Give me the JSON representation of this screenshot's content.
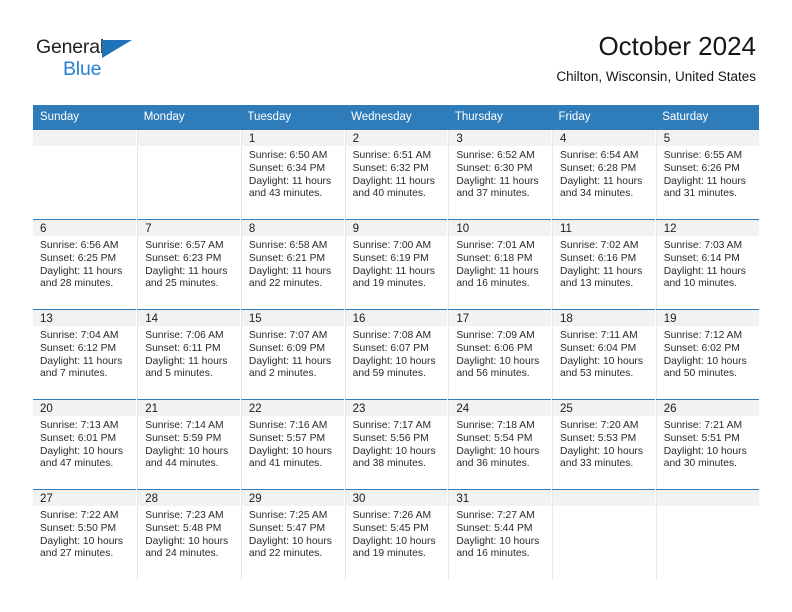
{
  "brand": {
    "name_part1": "General",
    "name_part2": "Blue",
    "triangle_color": "#1f72b8",
    "blue_color": "#2a7fd4"
  },
  "header": {
    "title": "October 2024",
    "subtitle": "Chilton, Wisconsin, United States"
  },
  "theme": {
    "header_row_color": "#2f7cba",
    "daynum_band_color": "#f2f2f2",
    "text_color": "#2a2a2a"
  },
  "weekday_headers": [
    "Sunday",
    "Monday",
    "Tuesday",
    "Wednesday",
    "Thursday",
    "Friday",
    "Saturday"
  ],
  "labels": {
    "sunrise_prefix": "Sunrise:",
    "sunset_prefix": "Sunset:",
    "daylight_prefix": "Daylight:"
  },
  "weeks": [
    [
      {
        "day": "",
        "sunrise": "",
        "sunset": "",
        "daylight_line1": "",
        "daylight_line2": ""
      },
      {
        "day": "",
        "sunrise": "",
        "sunset": "",
        "daylight_line1": "",
        "daylight_line2": ""
      },
      {
        "day": "1",
        "sunrise": "Sunrise: 6:50 AM",
        "sunset": "Sunset: 6:34 PM",
        "daylight_line1": "Daylight: 11 hours",
        "daylight_line2": "and 43 minutes."
      },
      {
        "day": "2",
        "sunrise": "Sunrise: 6:51 AM",
        "sunset": "Sunset: 6:32 PM",
        "daylight_line1": "Daylight: 11 hours",
        "daylight_line2": "and 40 minutes."
      },
      {
        "day": "3",
        "sunrise": "Sunrise: 6:52 AM",
        "sunset": "Sunset: 6:30 PM",
        "daylight_line1": "Daylight: 11 hours",
        "daylight_line2": "and 37 minutes."
      },
      {
        "day": "4",
        "sunrise": "Sunrise: 6:54 AM",
        "sunset": "Sunset: 6:28 PM",
        "daylight_line1": "Daylight: 11 hours",
        "daylight_line2": "and 34 minutes."
      },
      {
        "day": "5",
        "sunrise": "Sunrise: 6:55 AM",
        "sunset": "Sunset: 6:26 PM",
        "daylight_line1": "Daylight: 11 hours",
        "daylight_line2": "and 31 minutes."
      }
    ],
    [
      {
        "day": "6",
        "sunrise": "Sunrise: 6:56 AM",
        "sunset": "Sunset: 6:25 PM",
        "daylight_line1": "Daylight: 11 hours",
        "daylight_line2": "and 28 minutes."
      },
      {
        "day": "7",
        "sunrise": "Sunrise: 6:57 AM",
        "sunset": "Sunset: 6:23 PM",
        "daylight_line1": "Daylight: 11 hours",
        "daylight_line2": "and 25 minutes."
      },
      {
        "day": "8",
        "sunrise": "Sunrise: 6:58 AM",
        "sunset": "Sunset: 6:21 PM",
        "daylight_line1": "Daylight: 11 hours",
        "daylight_line2": "and 22 minutes."
      },
      {
        "day": "9",
        "sunrise": "Sunrise: 7:00 AM",
        "sunset": "Sunset: 6:19 PM",
        "daylight_line1": "Daylight: 11 hours",
        "daylight_line2": "and 19 minutes."
      },
      {
        "day": "10",
        "sunrise": "Sunrise: 7:01 AM",
        "sunset": "Sunset: 6:18 PM",
        "daylight_line1": "Daylight: 11 hours",
        "daylight_line2": "and 16 minutes."
      },
      {
        "day": "11",
        "sunrise": "Sunrise: 7:02 AM",
        "sunset": "Sunset: 6:16 PM",
        "daylight_line1": "Daylight: 11 hours",
        "daylight_line2": "and 13 minutes."
      },
      {
        "day": "12",
        "sunrise": "Sunrise: 7:03 AM",
        "sunset": "Sunset: 6:14 PM",
        "daylight_line1": "Daylight: 11 hours",
        "daylight_line2": "and 10 minutes."
      }
    ],
    [
      {
        "day": "13",
        "sunrise": "Sunrise: 7:04 AM",
        "sunset": "Sunset: 6:12 PM",
        "daylight_line1": "Daylight: 11 hours",
        "daylight_line2": "and 7 minutes."
      },
      {
        "day": "14",
        "sunrise": "Sunrise: 7:06 AM",
        "sunset": "Sunset: 6:11 PM",
        "daylight_line1": "Daylight: 11 hours",
        "daylight_line2": "and 5 minutes."
      },
      {
        "day": "15",
        "sunrise": "Sunrise: 7:07 AM",
        "sunset": "Sunset: 6:09 PM",
        "daylight_line1": "Daylight: 11 hours",
        "daylight_line2": "and 2 minutes."
      },
      {
        "day": "16",
        "sunrise": "Sunrise: 7:08 AM",
        "sunset": "Sunset: 6:07 PM",
        "daylight_line1": "Daylight: 10 hours",
        "daylight_line2": "and 59 minutes."
      },
      {
        "day": "17",
        "sunrise": "Sunrise: 7:09 AM",
        "sunset": "Sunset: 6:06 PM",
        "daylight_line1": "Daylight: 10 hours",
        "daylight_line2": "and 56 minutes."
      },
      {
        "day": "18",
        "sunrise": "Sunrise: 7:11 AM",
        "sunset": "Sunset: 6:04 PM",
        "daylight_line1": "Daylight: 10 hours",
        "daylight_line2": "and 53 minutes."
      },
      {
        "day": "19",
        "sunrise": "Sunrise: 7:12 AM",
        "sunset": "Sunset: 6:02 PM",
        "daylight_line1": "Daylight: 10 hours",
        "daylight_line2": "and 50 minutes."
      }
    ],
    [
      {
        "day": "20",
        "sunrise": "Sunrise: 7:13 AM",
        "sunset": "Sunset: 6:01 PM",
        "daylight_line1": "Daylight: 10 hours",
        "daylight_line2": "and 47 minutes."
      },
      {
        "day": "21",
        "sunrise": "Sunrise: 7:14 AM",
        "sunset": "Sunset: 5:59 PM",
        "daylight_line1": "Daylight: 10 hours",
        "daylight_line2": "and 44 minutes."
      },
      {
        "day": "22",
        "sunrise": "Sunrise: 7:16 AM",
        "sunset": "Sunset: 5:57 PM",
        "daylight_line1": "Daylight: 10 hours",
        "daylight_line2": "and 41 minutes."
      },
      {
        "day": "23",
        "sunrise": "Sunrise: 7:17 AM",
        "sunset": "Sunset: 5:56 PM",
        "daylight_line1": "Daylight: 10 hours",
        "daylight_line2": "and 38 minutes."
      },
      {
        "day": "24",
        "sunrise": "Sunrise: 7:18 AM",
        "sunset": "Sunset: 5:54 PM",
        "daylight_line1": "Daylight: 10 hours",
        "daylight_line2": "and 36 minutes."
      },
      {
        "day": "25",
        "sunrise": "Sunrise: 7:20 AM",
        "sunset": "Sunset: 5:53 PM",
        "daylight_line1": "Daylight: 10 hours",
        "daylight_line2": "and 33 minutes."
      },
      {
        "day": "26",
        "sunrise": "Sunrise: 7:21 AM",
        "sunset": "Sunset: 5:51 PM",
        "daylight_line1": "Daylight: 10 hours",
        "daylight_line2": "and 30 minutes."
      }
    ],
    [
      {
        "day": "27",
        "sunrise": "Sunrise: 7:22 AM",
        "sunset": "Sunset: 5:50 PM",
        "daylight_line1": "Daylight: 10 hours",
        "daylight_line2": "and 27 minutes."
      },
      {
        "day": "28",
        "sunrise": "Sunrise: 7:23 AM",
        "sunset": "Sunset: 5:48 PM",
        "daylight_line1": "Daylight: 10 hours",
        "daylight_line2": "and 24 minutes."
      },
      {
        "day": "29",
        "sunrise": "Sunrise: 7:25 AM",
        "sunset": "Sunset: 5:47 PM",
        "daylight_line1": "Daylight: 10 hours",
        "daylight_line2": "and 22 minutes."
      },
      {
        "day": "30",
        "sunrise": "Sunrise: 7:26 AM",
        "sunset": "Sunset: 5:45 PM",
        "daylight_line1": "Daylight: 10 hours",
        "daylight_line2": "and 19 minutes."
      },
      {
        "day": "31",
        "sunrise": "Sunrise: 7:27 AM",
        "sunset": "Sunset: 5:44 PM",
        "daylight_line1": "Daylight: 10 hours",
        "daylight_line2": "and 16 minutes."
      },
      {
        "day": "",
        "sunrise": "",
        "sunset": "",
        "daylight_line1": "",
        "daylight_line2": ""
      },
      {
        "day": "",
        "sunrise": "",
        "sunset": "",
        "daylight_line1": "",
        "daylight_line2": ""
      }
    ]
  ]
}
